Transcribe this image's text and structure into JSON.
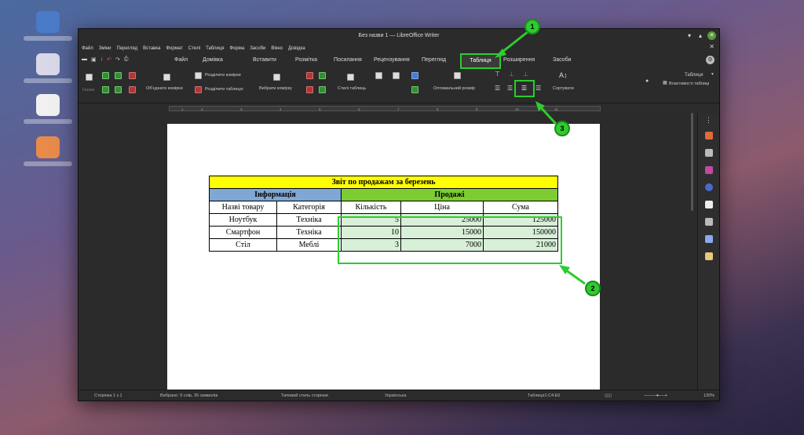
{
  "window": {
    "title": "Без назви 1 — LibreOffice Writer",
    "min_icon": "minimize-icon",
    "max_icon": "maximize-icon",
    "close_icon": "close-icon"
  },
  "menubar": [
    "Файл",
    "Зміни",
    "Перегляд",
    "Вставка",
    "Формат",
    "Стилі",
    "Таблиця",
    "Форма",
    "Засоби",
    "Вікно",
    "Довідка"
  ],
  "tabs": [
    "Файл",
    "Домівка",
    "Вставити",
    "Розмітка",
    "Посилання",
    "Рецензування",
    "Перегляд",
    "Таблиця",
    "Розширення",
    "Засоби"
  ],
  "active_tab": "Таблиця",
  "ribbon": {
    "insert": "Назва",
    "merge": "Об'єднати комірки",
    "split_cells": "Розділити комірки",
    "split_table": "Розділити таблицю",
    "select_cell": "Вибрати комірку",
    "table_styles": "Стилі таблиць",
    "optimal_size": "Оптимальний розмір",
    "sort": "Сортувати",
    "style_select": "Таблиця",
    "table_props": "Властивості таблиці"
  },
  "ruler_ticks": [
    "1",
    "2",
    "3",
    "4",
    "5",
    "6",
    "7",
    "8",
    "9",
    "10",
    "11"
  ],
  "table": {
    "title": "Звіт по продажам за березень",
    "group_info": "Інформація",
    "group_sales": "Продажі",
    "headers": [
      "Назві товару",
      "Категорія",
      "Кількість",
      "Ціна",
      "Сума"
    ],
    "rows": [
      [
        "Ноутбук",
        "Техніка",
        "5",
        "25000",
        "125000"
      ],
      [
        "Смартфон",
        "Техніка",
        "10",
        "15000",
        "150000"
      ],
      [
        "Стіл",
        "Меблі",
        "3",
        "7000",
        "21000"
      ]
    ]
  },
  "status": {
    "page": "Сторінка 1 з 1",
    "selection": "Вибрано: 9 слів, 35 символів",
    "page_style": "Типовий стиль сторінки",
    "language": "Українська",
    "cell": "Таблиця1:C4:E6",
    "zoom": "130%"
  },
  "callouts": [
    "1",
    "2",
    "3"
  ],
  "colors": {
    "highlight": "#2ecc2e",
    "title_row": "#ffff00",
    "info_header": "#7fa7d4",
    "sales_header": "#7ccc32"
  }
}
